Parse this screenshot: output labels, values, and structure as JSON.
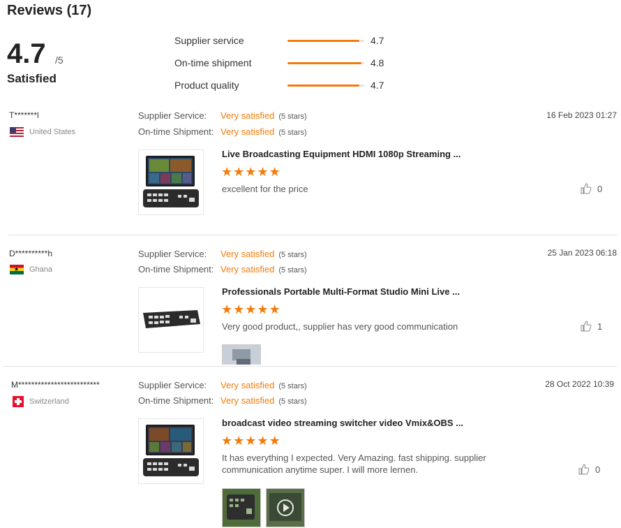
{
  "header": {
    "title": "Reviews (17)"
  },
  "summary": {
    "score": "4.7",
    "out_of": "/5",
    "verdict": "Satisfied",
    "ratings": [
      {
        "label": "Supplier service",
        "value": "4.7",
        "fraction": 0.94
      },
      {
        "label": "On-time shipment",
        "value": "4.8",
        "fraction": 0.96
      },
      {
        "label": "Product quality",
        "value": "4.7",
        "fraction": 0.94
      }
    ]
  },
  "labels": {
    "supplier_service": "Supplier Service:",
    "ontime_shipment": "On-time Shipment:",
    "star_glyph": "★"
  },
  "reviews": [
    {
      "reviewer": "T*******l",
      "country": "United States",
      "supplier_rating": "Very satisfied",
      "supplier_stars": "(5 stars)",
      "shipment_rating": "Very satisfied",
      "shipment_stars": "(5 stars)",
      "date": "16 Feb 2023 01:27",
      "product": "Live Broadcasting Equipment HDMI 1080p Streaming ...",
      "rating": 5,
      "comment": "excellent for the price",
      "likes": "0"
    },
    {
      "reviewer": "D**********h",
      "country": "Ghana",
      "supplier_rating": "Very satisfied",
      "supplier_stars": "(5 stars)",
      "shipment_rating": "Very satisfied",
      "shipment_stars": "(5 stars)",
      "date": "25 Jan 2023 06:18",
      "product": "Professionals Portable Multi-Format Studio Mini Live ...",
      "rating": 5,
      "comment": "Very good product,, supplier has very good communication",
      "likes": "1"
    },
    {
      "reviewer": "M*************************",
      "country": "Switzerland",
      "supplier_rating": "Very satisfied",
      "supplier_stars": "(5 stars)",
      "shipment_rating": "Very satisfied",
      "shipment_stars": "(5 stars)",
      "date": "28 Oct 2022 10:39",
      "product": "broadcast video streaming switcher video Vmix&OBS ...",
      "rating": 5,
      "comment": "It has everything I expected.  Very Amazing. fast shipping. supplier communication anytime super.  I will more lernen.",
      "likes": "0"
    }
  ],
  "icons": {
    "like": "thumbs-up-icon",
    "play": "play-icon"
  },
  "colors": {
    "accent": "#f47a09"
  }
}
